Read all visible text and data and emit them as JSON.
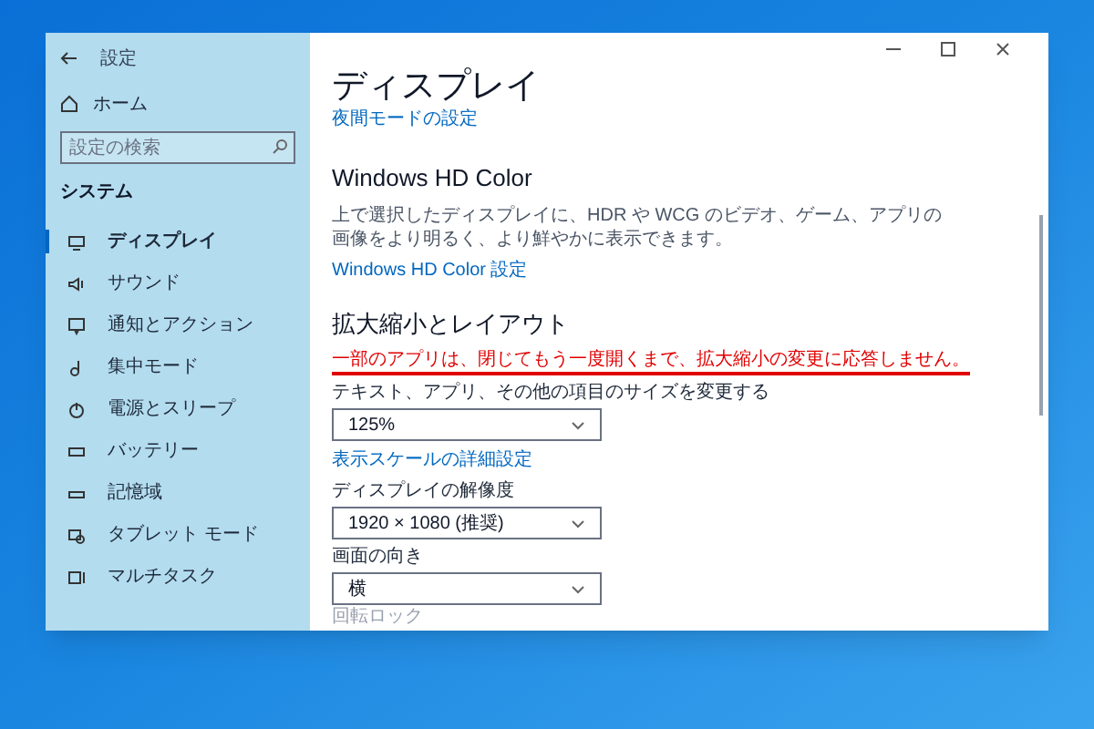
{
  "window": {
    "title": "設定"
  },
  "sidebar": {
    "home": "ホーム",
    "search": {
      "placeholder": "設定の検索"
    },
    "section": "システム",
    "items": [
      {
        "label": "ディスプレイ",
        "selected": true
      },
      {
        "label": "サウンド",
        "selected": false
      },
      {
        "label": "通知とアクション",
        "selected": false
      },
      {
        "label": "集中モード",
        "selected": false
      },
      {
        "label": "電源とスリープ",
        "selected": false
      },
      {
        "label": "バッテリー",
        "selected": false
      },
      {
        "label": "記憶域",
        "selected": false
      },
      {
        "label": "タブレット モード",
        "selected": false
      },
      {
        "label": "マルチタスク",
        "selected": false
      }
    ]
  },
  "content": {
    "title": "ディスプレイ",
    "night_link": "夜間モードの設定",
    "hd_color": {
      "heading": "Windows HD Color",
      "description": "上で選択したディスプレイに、HDR や WCG のビデオ、ゲーム、アプリの画像をより明るく、より鮮やかに表示できます。",
      "link": "Windows HD Color 設定"
    },
    "scale": {
      "heading": "拡大縮小とレイアウト",
      "warning": "一部のアプリは、閉じてもう一度開くまで、拡大縮小の変更に応答しません。",
      "fields": [
        {
          "label": "テキスト、アプリ、その他の項目のサイズを変更する",
          "value": "125%",
          "link": "表示スケールの詳細設定"
        },
        {
          "label": "ディスプレイの解像度",
          "value": "1920 × 1080 (推奨)"
        },
        {
          "label": "画面の向き",
          "value": "横"
        }
      ],
      "next_label": "回転ロック"
    }
  }
}
